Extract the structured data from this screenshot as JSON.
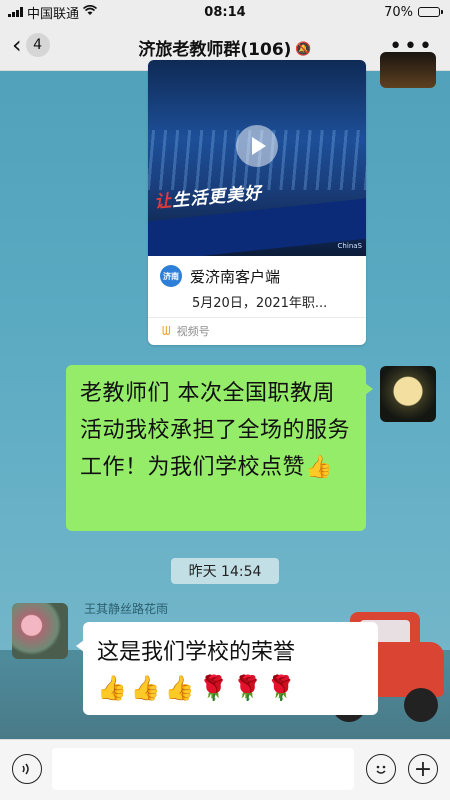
{
  "status_bar": {
    "carrier": "中国联通",
    "time": "08:14",
    "battery": "70%",
    "battery_level": 0.7
  },
  "nav": {
    "back_count": "4",
    "title": "济旅老教师群(106)"
  },
  "messages": {
    "video_card": {
      "slogan_prefix": "让",
      "slogan_main": "生活更美好",
      "watermark": "ChinaS",
      "source_logo": "济南",
      "source_name": "爱济南客户端",
      "description": "5月20日，2021年职...",
      "channel": "视频号"
    },
    "outgoing_text": "老教师们 本次全国职教周活动我校承担了全场的服务工作！为我们学校点赞👍",
    "timestamp": "昨天 14:54",
    "incoming_sender": "王其静丝路花雨",
    "incoming_text": "这是我们学校的荣誉",
    "incoming_emojis": "👍👍👍🌹🌹🌹"
  },
  "input_bar": {
    "placeholder": ""
  },
  "icons": {
    "back": "chevron-left-icon",
    "mute": "mute-bell-icon",
    "more": "more-dots-icon",
    "play": "play-icon",
    "voice": "voice-icon",
    "emoji": "emoji-icon",
    "plus": "plus-icon"
  },
  "colors": {
    "outgoing_bubble": "#95ec69",
    "incoming_bubble": "#ffffff",
    "bar_bg": "#ededed"
  }
}
